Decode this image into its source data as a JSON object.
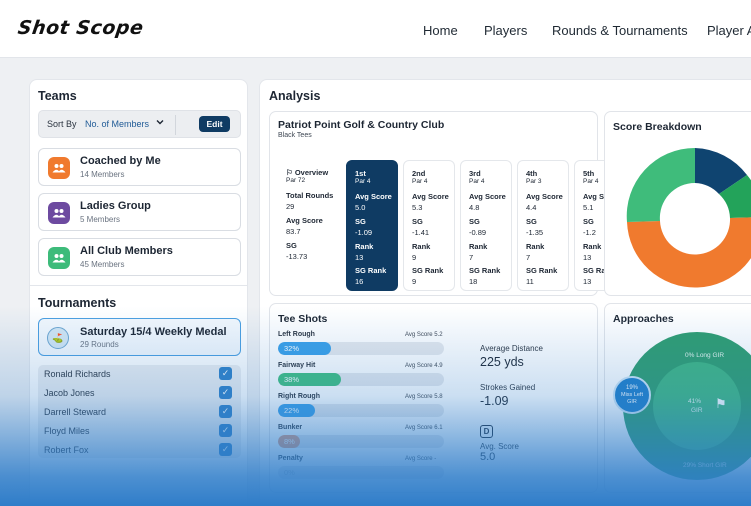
{
  "brand": {
    "logo_text": "Shot Scope"
  },
  "nav": {
    "items": [
      "Home",
      "Players",
      "Rounds & Tournaments",
      "Player A"
    ]
  },
  "teams": {
    "title": "Teams",
    "sort_label": "Sort By",
    "sort_value": "No. of Members",
    "edit_label": "Edit",
    "items": [
      {
        "name": "Coached by Me",
        "members": "14 Members",
        "color": "#f07a2e"
      },
      {
        "name": "Ladies Group",
        "members": "5 Members",
        "color": "#6d4aa0"
      },
      {
        "name": "All Club Members",
        "members": "45 Members",
        "color": "#3dbb7a"
      }
    ]
  },
  "tournaments": {
    "title": "Tournaments",
    "selected": {
      "name": "Saturday 15/4 Weekly Medal",
      "rounds": "29 Rounds"
    },
    "players": [
      "Ronald Richards",
      "Jacob Jones",
      "Darrell Steward",
      "Floyd Miles",
      "Robert Fox"
    ]
  },
  "analysis": {
    "title": "Analysis",
    "course": {
      "name": "Patriot Point Golf & Country Club",
      "tees": "Black Tees"
    },
    "overview": {
      "label": "Overview",
      "par": "Par 72",
      "total_rounds_label": "Total Rounds",
      "total_rounds": "29",
      "avg_score_label": "Avg Score",
      "avg_score": "83.7",
      "sg_label": "SG",
      "sg": "-13.73"
    },
    "holes": [
      {
        "label": "1st",
        "par": "Par 4",
        "avg_score": "5.0",
        "sg": "-1.09",
        "rank": "13",
        "sg_rank": "16",
        "selected": true
      },
      {
        "label": "2nd",
        "par": "Par 4",
        "avg_score": "5.3",
        "sg": "-1.41",
        "rank": "9",
        "sg_rank": "9",
        "selected": false
      },
      {
        "label": "3rd",
        "par": "Par 4",
        "avg_score": "4.8",
        "sg": "-0.89",
        "rank": "7",
        "sg_rank": "18",
        "selected": false
      },
      {
        "label": "4th",
        "par": "Par 3",
        "avg_score": "4.4",
        "sg": "-1.35",
        "rank": "7",
        "sg_rank": "11",
        "selected": false
      },
      {
        "label": "5th",
        "par": "Par 4",
        "avg_score": "5.1",
        "sg": "-1.2",
        "rank": "13",
        "sg_rank": "13",
        "selected": false
      }
    ],
    "labels": {
      "avg_score": "Avg Score",
      "sg": "SG",
      "rank": "Rank",
      "sg_rank": "SG Rank"
    },
    "score_breakdown": {
      "title": "Score Breakdown",
      "colors": [
        "#0f4470",
        "#23a35a",
        "#f07a2e",
        "#3fbc7b"
      ]
    },
    "tee_shots": {
      "title": "Tee Shots",
      "bars": [
        {
          "label": "Left Rough",
          "pct": 32,
          "pct_text": "32%",
          "avg": "Avg Score 5.2",
          "color": "#3aa0e8"
        },
        {
          "label": "Fairway Hit",
          "pct": 38,
          "pct_text": "38%",
          "avg": "Avg Score 4.9",
          "color": "#3fbf7f"
        },
        {
          "label": "Right Rough",
          "pct": 22,
          "pct_text": "22%",
          "avg": "Avg Score 5.8",
          "color": "#3aa0e8"
        },
        {
          "label": "Bunker",
          "pct": 8,
          "pct_text": "8%",
          "avg": "Avg Score 6.1",
          "color": "#e79a7a"
        },
        {
          "label": "Penalty",
          "pct": 0,
          "pct_text": "0%",
          "avg": "Avg Score -",
          "color": "#c9ced6"
        }
      ],
      "avg_distance_label": "Average Distance",
      "avg_distance": "225 yds",
      "strokes_gained_label": "Strokes Gained",
      "strokes_gained": "-1.09",
      "d_badge": "D",
      "d_avg_label": "Avg. Score",
      "d_avg": "5.0"
    },
    "approaches": {
      "title": "Approaches",
      "long_gir": "0% Long GIR",
      "gir_pct": "41%",
      "gir_label": "GIR",
      "miss_left_pct": "19%",
      "miss_left_label": "Miss Left",
      "miss_left_sub": "GIR",
      "short_gir": "29% Short GIR"
    }
  }
}
